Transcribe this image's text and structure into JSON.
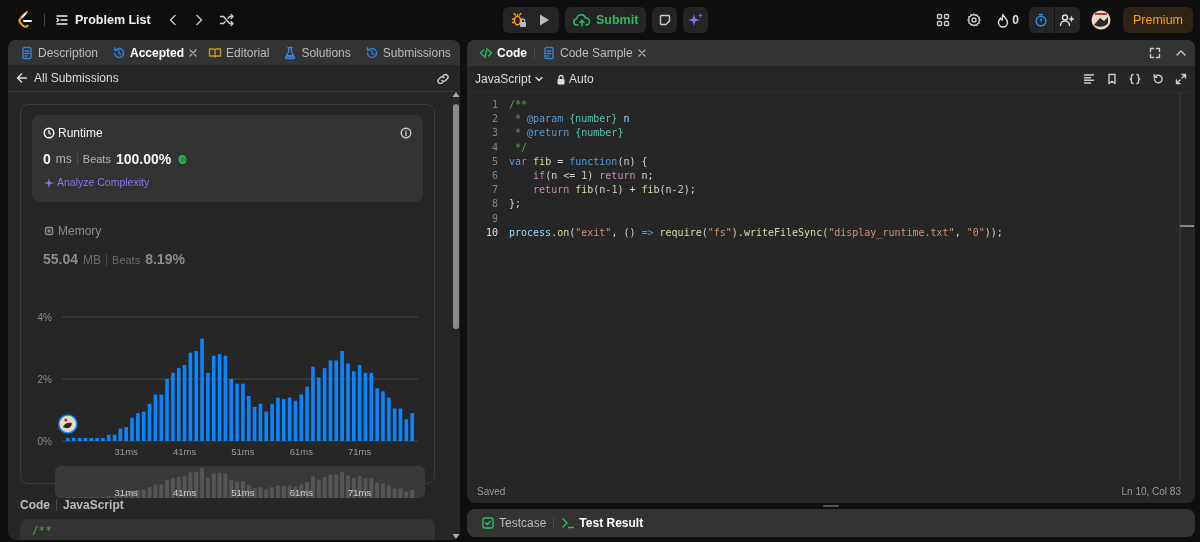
{
  "nav": {
    "problem_list": "Problem List",
    "submit": "Submit",
    "streak": "0",
    "premium": "Premium"
  },
  "left_panel": {
    "tabs": [
      {
        "label": "Description",
        "selected": false,
        "closable": false
      },
      {
        "label": "Accepted",
        "selected": true,
        "closable": true
      },
      {
        "label": "Editorial",
        "selected": false,
        "closable": false
      },
      {
        "label": "Solutions",
        "selected": false,
        "closable": false
      },
      {
        "label": "Submissions",
        "selected": false,
        "closable": false
      }
    ],
    "back_link": "All Submissions",
    "stats": [
      {
        "kind": "runtime",
        "title": "Runtime",
        "value": "0",
        "unit": "ms",
        "beats_label": "Beats",
        "beats": "100.00%",
        "analyze": "Analyze Complexity",
        "selected": true
      },
      {
        "kind": "memory",
        "title": "Memory",
        "value": "55.04",
        "unit": "MB",
        "beats_label": "Beats",
        "beats": "8.19%",
        "selected": false
      }
    ],
    "distribution": {
      "chart_data": {
        "type": "bar",
        "x": [
          21,
          22,
          23,
          24,
          25,
          26,
          27,
          28,
          29,
          30,
          31,
          32,
          33,
          34,
          35,
          36,
          37,
          38,
          39,
          40,
          41,
          42,
          43,
          44,
          45,
          46,
          47,
          48,
          49,
          50,
          51,
          52,
          53,
          54,
          55,
          56,
          57,
          58,
          59,
          60,
          61,
          62,
          63,
          64,
          65,
          66,
          67,
          68,
          69,
          70,
          71,
          72,
          73,
          74,
          75,
          76,
          77,
          78,
          79,
          80
        ],
        "values": [
          0.1,
          0.1,
          0.1,
          0.1,
          0.1,
          0.1,
          0.1,
          0.2,
          0.2,
          0.4,
          0.45,
          0.75,
          0.9,
          0.95,
          1.2,
          1.5,
          1.5,
          2.0,
          2.2,
          2.35,
          2.45,
          2.85,
          2.9,
          3.3,
          2.2,
          2.75,
          2.8,
          2.75,
          2.0,
          1.85,
          1.85,
          1.45,
          1.1,
          1.2,
          0.95,
          1.2,
          1.4,
          1.35,
          1.4,
          1.3,
          1.5,
          1.75,
          2.4,
          2.05,
          2.35,
          2.6,
          2.6,
          2.9,
          2.5,
          2.25,
          2.45,
          2.2,
          2.2,
          1.7,
          1.6,
          1.4,
          1.05,
          1.05,
          0.7,
          0.9
        ],
        "xlim": [
          20,
          81
        ],
        "ylim": [
          0,
          4
        ],
        "yticks": [
          {
            "value": 0,
            "label": "0%"
          },
          {
            "value": 2,
            "label": "2%"
          },
          {
            "value": 4,
            "label": "4%"
          }
        ],
        "xticks": [
          {
            "value": 31,
            "label": "31ms"
          },
          {
            "value": 41,
            "label": "41ms"
          },
          {
            "value": 51,
            "label": "51ms"
          },
          {
            "value": 61,
            "label": "61ms"
          },
          {
            "value": 71,
            "label": "71ms"
          }
        ]
      },
      "overview_labels": [
        "31ms",
        "41ms",
        "51ms",
        "61ms",
        "71ms"
      ]
    },
    "code_header": {
      "label": "Code",
      "language": "JavaScript"
    },
    "code_preview": "/**"
  },
  "editor": {
    "tabs": [
      {
        "label": "Code",
        "selected": true,
        "closable": false
      },
      {
        "label": "Code Sample",
        "selected": false,
        "closable": true
      }
    ],
    "language": "JavaScript",
    "mode": "Auto",
    "lines": [
      {
        "number": "1",
        "current": false,
        "tokens": [
          {
            "text": "/**",
            "kind": "comment"
          }
        ]
      },
      {
        "number": "2",
        "current": false,
        "tokens": [
          {
            "text": " * ",
            "kind": "comment"
          },
          {
            "text": "@param",
            "kind": "tag"
          },
          {
            "text": " {number}",
            "kind": "type"
          },
          {
            "text": " n",
            "kind": "variable"
          }
        ]
      },
      {
        "number": "3",
        "current": false,
        "tokens": [
          {
            "text": " * ",
            "kind": "comment"
          },
          {
            "text": "@return",
            "kind": "tag"
          },
          {
            "text": " {number}",
            "kind": "type"
          }
        ]
      },
      {
        "number": "4",
        "current": false,
        "tokens": [
          {
            "text": " */",
            "kind": "comment"
          }
        ]
      },
      {
        "number": "5",
        "current": false,
        "tokens": [
          {
            "text": "var ",
            "kind": "keyword"
          },
          {
            "text": "fib",
            "kind": "func"
          },
          {
            "text": " = ",
            "kind": "plain"
          },
          {
            "text": "function",
            "kind": "keyword"
          },
          {
            "text": "(n) {",
            "kind": "plain"
          }
        ]
      },
      {
        "number": "6",
        "current": false,
        "tokens": [
          {
            "text": "    if",
            "kind": "control"
          },
          {
            "text": "(n <= ",
            "kind": "plain"
          },
          {
            "text": "1",
            "kind": "number"
          },
          {
            "text": ") ",
            "kind": "plain"
          },
          {
            "text": "return",
            "kind": "control"
          },
          {
            "text": " n;",
            "kind": "plain"
          }
        ]
      },
      {
        "number": "7",
        "current": false,
        "tokens": [
          {
            "text": "    return",
            "kind": "control"
          },
          {
            "text": " fib",
            "kind": "func"
          },
          {
            "text": "(n-",
            "kind": "plain"
          },
          {
            "text": "1",
            "kind": "number"
          },
          {
            "text": ") + ",
            "kind": "plain"
          },
          {
            "text": "fib",
            "kind": "func"
          },
          {
            "text": "(n-",
            "kind": "plain"
          },
          {
            "text": "2",
            "kind": "number"
          },
          {
            "text": ");",
            "kind": "plain"
          }
        ]
      },
      {
        "number": "8",
        "current": false,
        "tokens": [
          {
            "text": "};",
            "kind": "plain"
          }
        ]
      },
      {
        "number": "9",
        "current": false
      },
      {
        "number": "10",
        "current": true,
        "tokens": [
          {
            "text": "process",
            "kind": "variable"
          },
          {
            "text": ".",
            "kind": "plain"
          },
          {
            "text": "on",
            "kind": "func"
          },
          {
            "text": "(",
            "kind": "plain"
          },
          {
            "text": "\"exit\"",
            "kind": "string"
          },
          {
            "text": ", () ",
            "kind": "plain"
          },
          {
            "text": "=> ",
            "kind": "keyword"
          },
          {
            "text": "require",
            "kind": "func"
          },
          {
            "text": "(",
            "kind": "plain"
          },
          {
            "text": "\"fs\"",
            "kind": "string"
          },
          {
            "text": ").",
            "kind": "plain"
          },
          {
            "text": "writeFileSync",
            "kind": "func"
          },
          {
            "text": "(",
            "kind": "plain"
          },
          {
            "text": "\"display_runtime.txt\"",
            "kind": "string"
          },
          {
            "text": ", ",
            "kind": "plain"
          },
          {
            "text": "\"0\"",
            "kind": "string"
          },
          {
            "text": "));",
            "kind": "plain"
          }
        ]
      }
    ],
    "status": "Saved",
    "cursor": "Ln 10, Col 83"
  },
  "bottom_panel": {
    "tabs": [
      {
        "label": "Testcase",
        "selected": false
      },
      {
        "label": "Test Result",
        "selected": true
      }
    ]
  }
}
